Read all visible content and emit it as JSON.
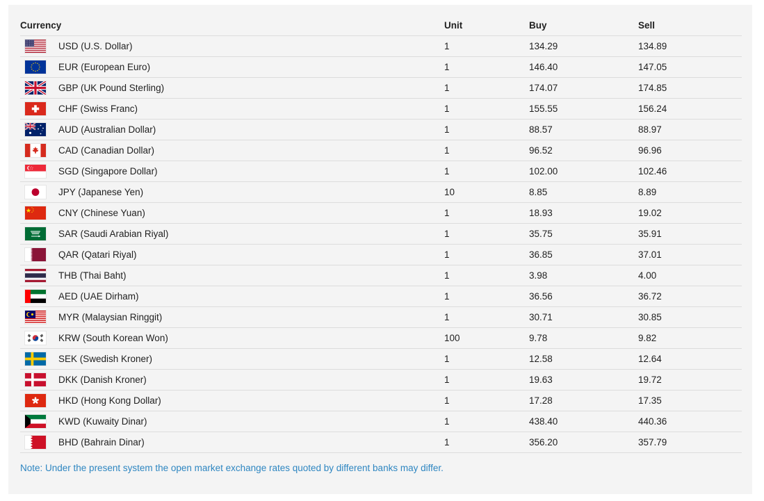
{
  "table": {
    "headers": {
      "currency": "Currency",
      "unit": "Unit",
      "buy": "Buy",
      "sell": "Sell"
    },
    "rows": [
      {
        "flag": "us-flag-icon",
        "currency": "USD (U.S. Dollar)",
        "unit": "1",
        "buy": "134.29",
        "sell": "134.89"
      },
      {
        "flag": "eu-flag-icon",
        "currency": "EUR (European Euro)",
        "unit": "1",
        "buy": "146.40",
        "sell": "147.05"
      },
      {
        "flag": "gb-flag-icon",
        "currency": "GBP (UK Pound Sterling)",
        "unit": "1",
        "buy": "174.07",
        "sell": "174.85"
      },
      {
        "flag": "ch-flag-icon",
        "currency": "CHF (Swiss Franc)",
        "unit": "1",
        "buy": "155.55",
        "sell": "156.24"
      },
      {
        "flag": "au-flag-icon",
        "currency": "AUD (Australian Dollar)",
        "unit": "1",
        "buy": "88.57",
        "sell": "88.97"
      },
      {
        "flag": "ca-flag-icon",
        "currency": "CAD (Canadian Dollar)",
        "unit": "1",
        "buy": "96.52",
        "sell": "96.96"
      },
      {
        "flag": "sg-flag-icon",
        "currency": "SGD (Singapore Dollar)",
        "unit": "1",
        "buy": "102.00",
        "sell": "102.46"
      },
      {
        "flag": "jp-flag-icon",
        "currency": "JPY (Japanese Yen)",
        "unit": "10",
        "buy": "8.85",
        "sell": "8.89"
      },
      {
        "flag": "cn-flag-icon",
        "currency": "CNY (Chinese Yuan)",
        "unit": "1",
        "buy": "18.93",
        "sell": "19.02"
      },
      {
        "flag": "sa-flag-icon",
        "currency": "SAR (Saudi Arabian Riyal)",
        "unit": "1",
        "buy": "35.75",
        "sell": "35.91"
      },
      {
        "flag": "qa-flag-icon",
        "currency": "QAR (Qatari Riyal)",
        "unit": "1",
        "buy": "36.85",
        "sell": "37.01"
      },
      {
        "flag": "th-flag-icon",
        "currency": "THB (Thai Baht)",
        "unit": "1",
        "buy": "3.98",
        "sell": "4.00"
      },
      {
        "flag": "ae-flag-icon",
        "currency": "AED (UAE Dirham)",
        "unit": "1",
        "buy": "36.56",
        "sell": "36.72"
      },
      {
        "flag": "my-flag-icon",
        "currency": "MYR (Malaysian Ringgit)",
        "unit": "1",
        "buy": "30.71",
        "sell": "30.85"
      },
      {
        "flag": "kr-flag-icon",
        "currency": "KRW (South Korean Won)",
        "unit": "100",
        "buy": "9.78",
        "sell": "9.82"
      },
      {
        "flag": "se-flag-icon",
        "currency": "SEK (Swedish Kroner)",
        "unit": "1",
        "buy": "12.58",
        "sell": "12.64"
      },
      {
        "flag": "dk-flag-icon",
        "currency": "DKK (Danish Kroner)",
        "unit": "1",
        "buy": "19.63",
        "sell": "19.72"
      },
      {
        "flag": "hk-flag-icon",
        "currency": "HKD (Hong Kong Dollar)",
        "unit": "1",
        "buy": "17.28",
        "sell": "17.35"
      },
      {
        "flag": "kw-flag-icon",
        "currency": "KWD (Kuwaity Dinar)",
        "unit": "1",
        "buy": "438.40",
        "sell": "440.36"
      },
      {
        "flag": "bh-flag-icon",
        "currency": "BHD (Bahrain Dinar)",
        "unit": "1",
        "buy": "356.20",
        "sell": "357.79"
      }
    ]
  },
  "note": "Note: Under the present system the open market exchange rates quoted by different banks may differ.",
  "colors": {
    "panel_background": "#f4f4f4",
    "row_divider": "#dcdcdc",
    "note_text": "#2e86c1"
  }
}
